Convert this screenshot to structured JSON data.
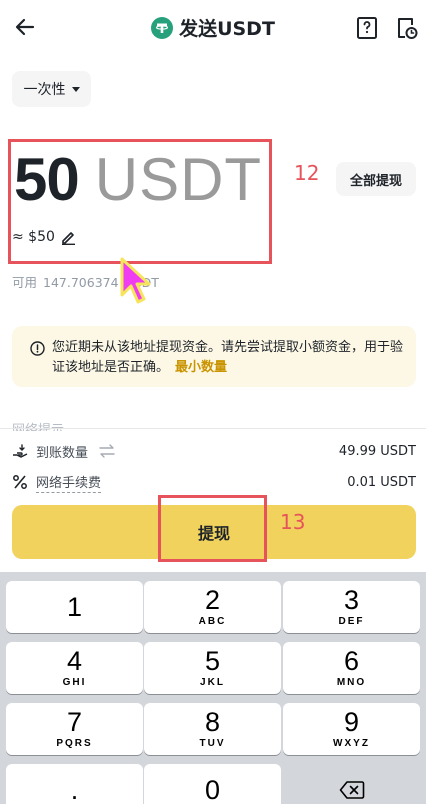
{
  "header": {
    "title": "发送USDT"
  },
  "mode_select": {
    "label": "一次性"
  },
  "amount": {
    "value": "50",
    "unit": "USDT",
    "fiat": "≈ $50",
    "max_label": "全部提现"
  },
  "available": {
    "label": "可用",
    "value": "147.706374",
    "unit": "USDT"
  },
  "notice": {
    "text": "您近期未从该地址提现资金。请先尝试提取小额资金，用于验证该地址是否正确。",
    "link": "最小数量"
  },
  "summary": {
    "receive_label": "到账数量",
    "receive_value": "49.99 USDT",
    "fee_label": "网络手续费",
    "fee_value": "0.01 USDT"
  },
  "withdraw_label": "提现",
  "keypad": [
    {
      "num": "1",
      "letters": ""
    },
    {
      "num": "2",
      "letters": "ABC"
    },
    {
      "num": "3",
      "letters": "DEF"
    },
    {
      "num": "4",
      "letters": "GHI"
    },
    {
      "num": "5",
      "letters": "JKL"
    },
    {
      "num": "6",
      "letters": "MNO"
    },
    {
      "num": "7",
      "letters": "PQRS"
    },
    {
      "num": "8",
      "letters": "TUV"
    },
    {
      "num": "9",
      "letters": "WXYZ"
    },
    {
      "num": ".",
      "letters": ""
    },
    {
      "num": "0",
      "letters": ""
    }
  ],
  "annotations": {
    "amount_step": "12",
    "withdraw_step": "13",
    "color": "#e7535a"
  },
  "colors": {
    "accent": "#f0d25c",
    "link": "#c99400",
    "notice_bg": "#fdf8e6",
    "cursor": "#f03cf0"
  }
}
